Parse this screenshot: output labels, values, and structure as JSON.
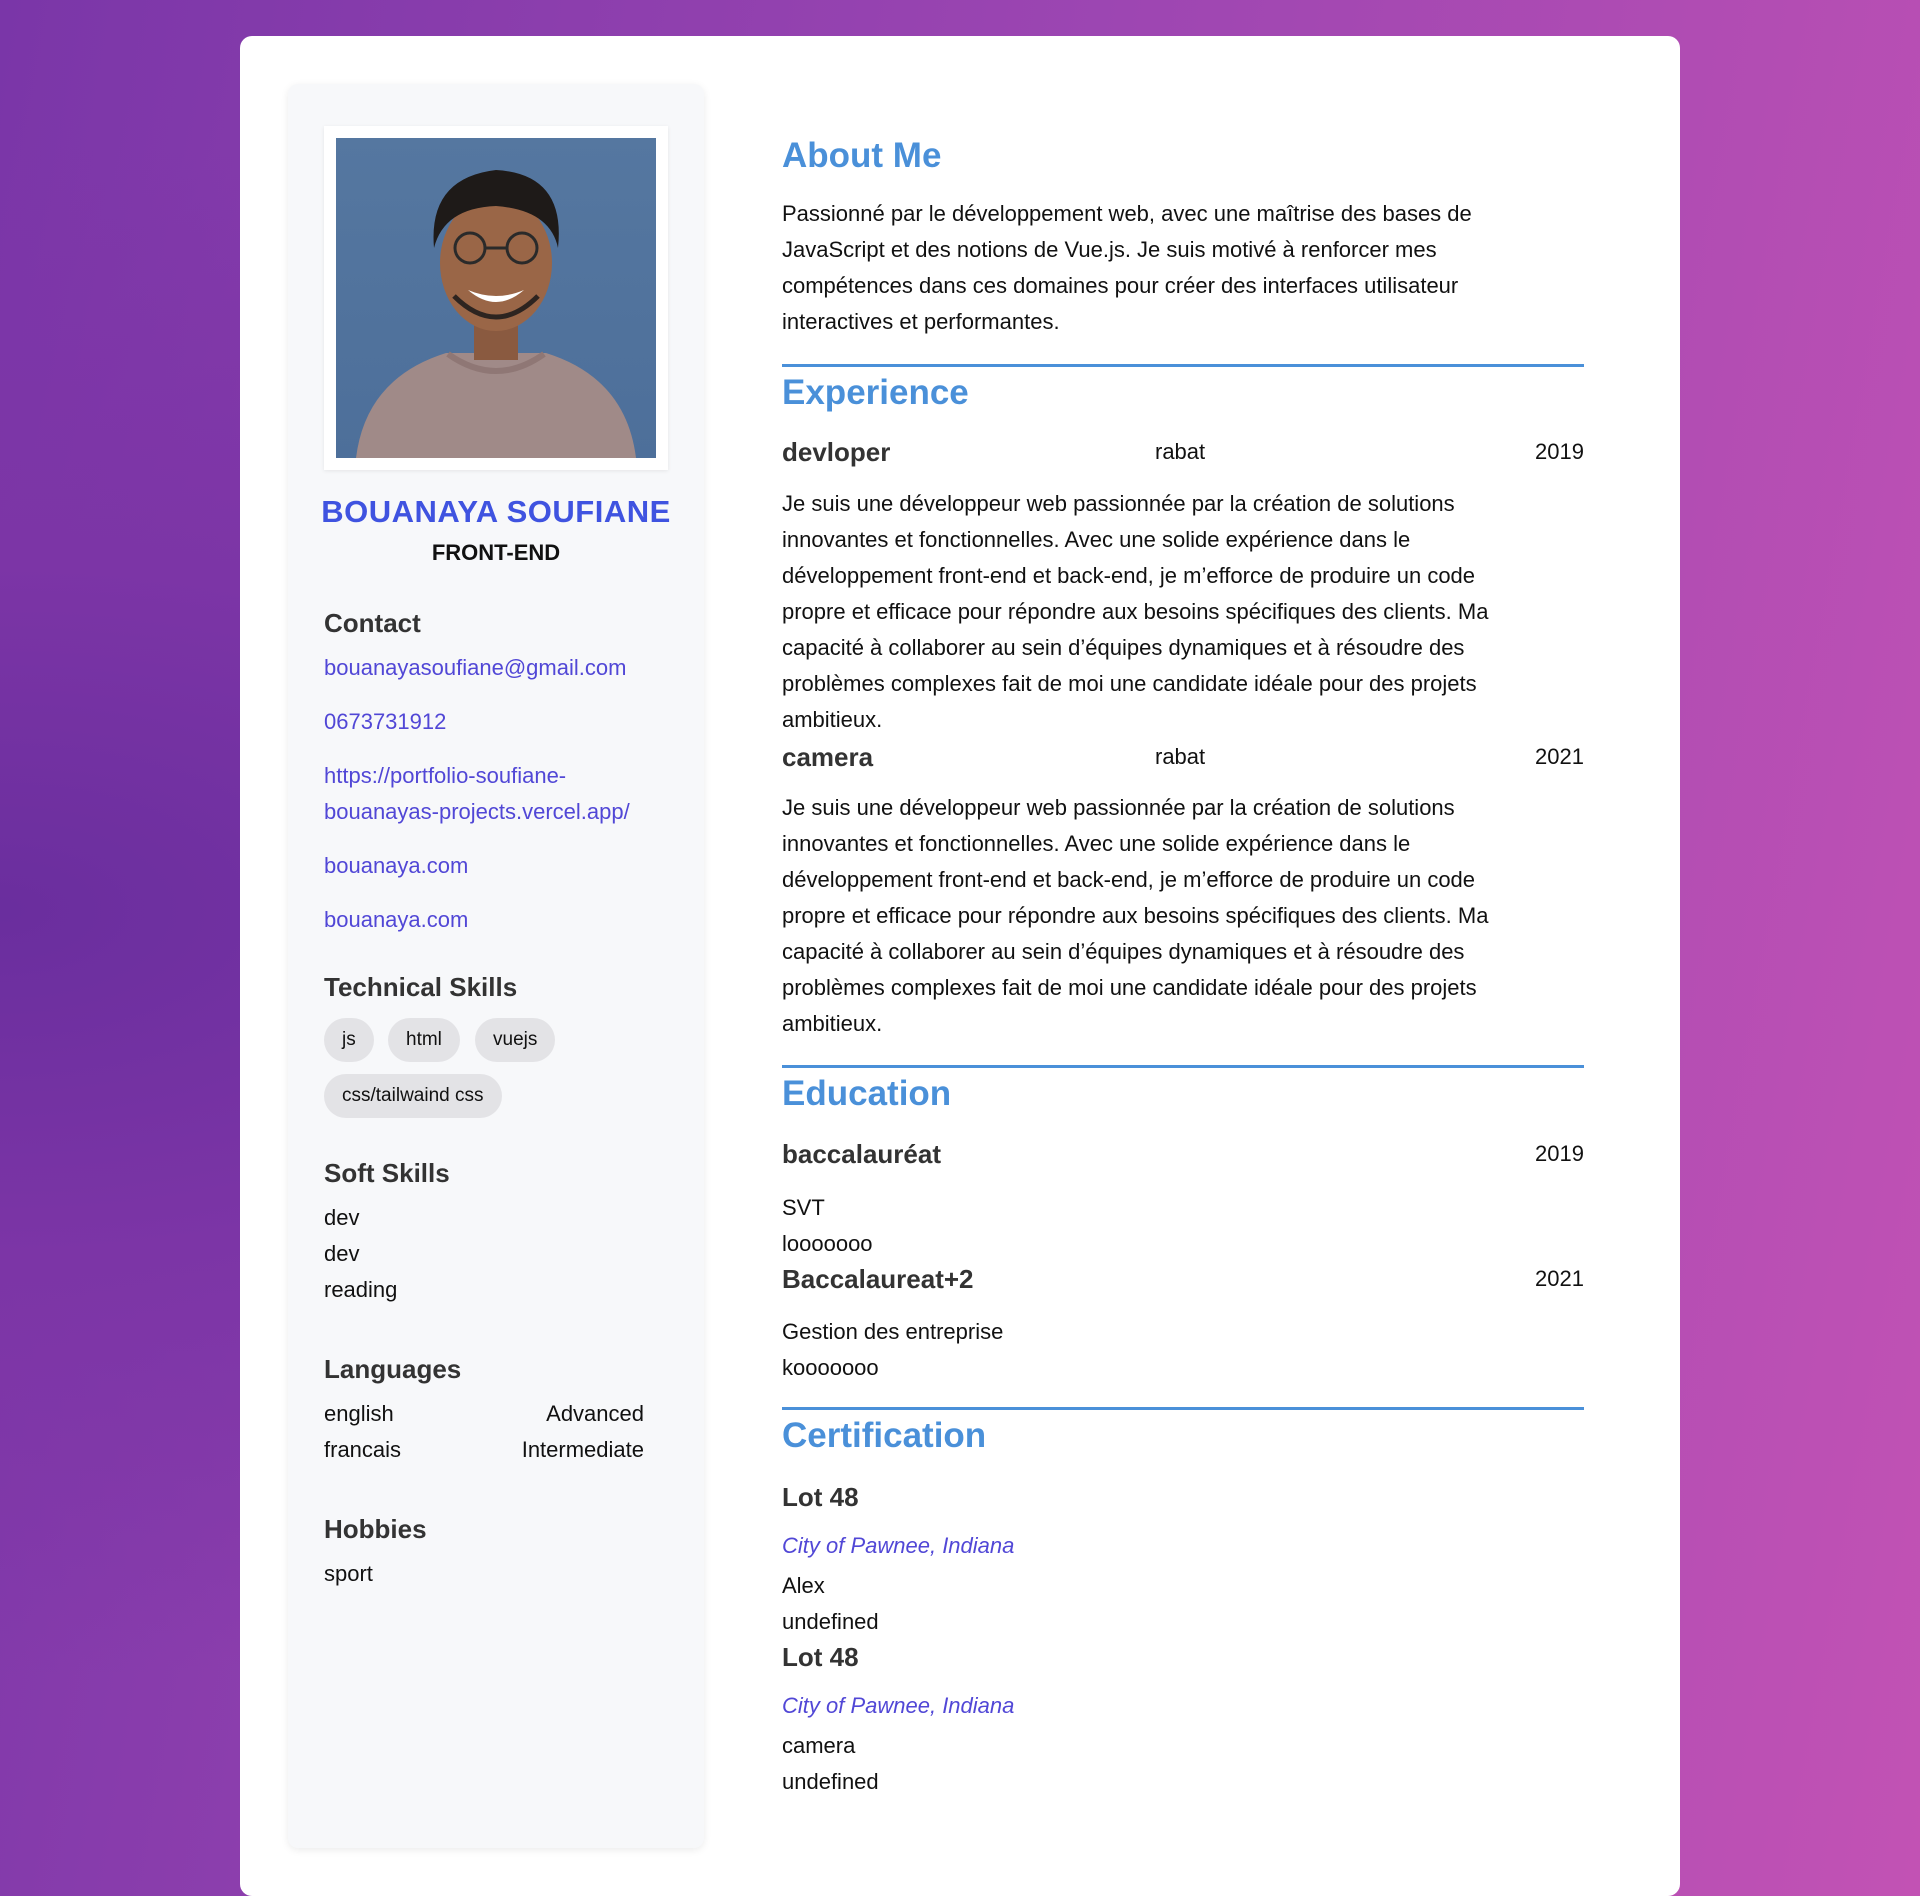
{
  "profile": {
    "name": "BOUANAYA SOUFIANE",
    "role": "FRONT-END",
    "photo_alt": "Profile photo"
  },
  "contact": {
    "heading": "Contact",
    "email": "bouanayasoufiane@gmail.com",
    "phone": "0673731912",
    "portfolio_line1": "https://portfolio-soufiane-",
    "portfolio_line2": "bouanayas-projects.vercel.app/",
    "link1": "bouanaya.com",
    "link2": "bouanaya.com"
  },
  "technical_skills": {
    "heading": "Technical Skills",
    "items": [
      "js",
      "html",
      "vuejs",
      "css/tailwaind css"
    ]
  },
  "soft_skills": {
    "heading": "Soft Skills",
    "items": [
      "dev",
      "dev",
      "reading"
    ]
  },
  "languages": {
    "heading": "Languages",
    "items": [
      {
        "name": "english",
        "level": "Advanced"
      },
      {
        "name": "francais",
        "level": "Intermediate"
      }
    ]
  },
  "hobbies": {
    "heading": "Hobbies",
    "items": [
      "sport"
    ]
  },
  "about": {
    "heading": "About Me",
    "lines": [
      "Passionné par le développement web, avec une maîtrise des bases de",
      "JavaScript et des notions de Vue.js. Je suis motivé à renforcer mes",
      "compétences dans ces domaines pour créer des interfaces utilisateur",
      "interactives et performantes."
    ]
  },
  "experience": {
    "heading": "Experience",
    "items": [
      {
        "title": "devloper",
        "location": "rabat",
        "year": "2019",
        "lines": [
          "Je suis une développeur web passionnée par la création de solutions",
          "innovantes et fonctionnelles. Avec une solide expérience dans le",
          "développement front-end et back-end, je m’efforce de produire un code",
          "propre et efficace pour répondre aux besoins spécifiques des clients. Ma",
          "capacité à collaborer au sein d’équipes dynamiques et à résoudre des",
          "problèmes complexes fait de moi une candidate idéale pour des projets",
          "ambitieux."
        ]
      },
      {
        "title": "camera",
        "location": "rabat",
        "year": "2021",
        "lines": [
          "Je suis une développeur web passionnée par la création de solutions",
          "innovantes et fonctionnelles. Avec une solide expérience dans le",
          "développement front-end et back-end, je m’efforce de produire un code",
          "propre et efficace pour répondre aux besoins spécifiques des clients. Ma",
          "capacité à collaborer au sein d’équipes dynamiques et à résoudre des",
          "problèmes complexes fait de moi une candidate idéale pour des projets",
          "ambitieux."
        ]
      }
    ]
  },
  "education": {
    "heading": "Education",
    "items": [
      {
        "title": "baccalauréat",
        "year": "2019",
        "field": "SVT",
        "detail": "looooooo"
      },
      {
        "title": "Baccalaureat+2",
        "year": "2021",
        "field": "Gestion des entreprise",
        "detail": "kooooooo"
      }
    ]
  },
  "certification": {
    "heading": "Certification",
    "items": [
      {
        "title": "Lot 48",
        "org": "City of Pawnee, Indiana",
        "person": "Alex",
        "extra": "undefined"
      },
      {
        "title": "Lot 48",
        "org": "City of Pawnee, Indiana",
        "person": "camera",
        "extra": "undefined"
      }
    ]
  },
  "colors": {
    "accent_blue": "#4a90d9",
    "name_blue": "#3f53e0",
    "link_purple": "#5147d6",
    "background_gradient_start": "#7a36a8",
    "background_gradient_end": "#c252b4"
  }
}
